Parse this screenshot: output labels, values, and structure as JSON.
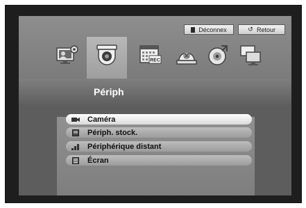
{
  "header": {
    "logout_label": "Déconnex",
    "back_label": "Retour"
  },
  "nav": {
    "icons": [
      {
        "name": "system-settings-icon"
      },
      {
        "name": "camera-device-icon",
        "selected": true
      },
      {
        "name": "record-schedule-icon",
        "badge": "REC"
      },
      {
        "name": "event-alarm-icon"
      },
      {
        "name": "backup-disc-icon"
      },
      {
        "name": "network-monitors-icon"
      }
    ]
  },
  "section": {
    "title": "Périph"
  },
  "menu": {
    "items": [
      {
        "label": "Caméra",
        "icon": "camera-icon",
        "active": true
      },
      {
        "label": "Périph. stock.",
        "icon": "storage-icon",
        "active": false
      },
      {
        "label": "Périphérique distant",
        "icon": "remote-device-icon",
        "active": false
      },
      {
        "label": "Écran",
        "icon": "monitor-icon",
        "active": false
      }
    ]
  },
  "colors": {
    "background": "#1e1e1e",
    "panel": "#6f6f6f",
    "active_item": "#ffffff",
    "inactive_item": "#a8a8a8"
  }
}
